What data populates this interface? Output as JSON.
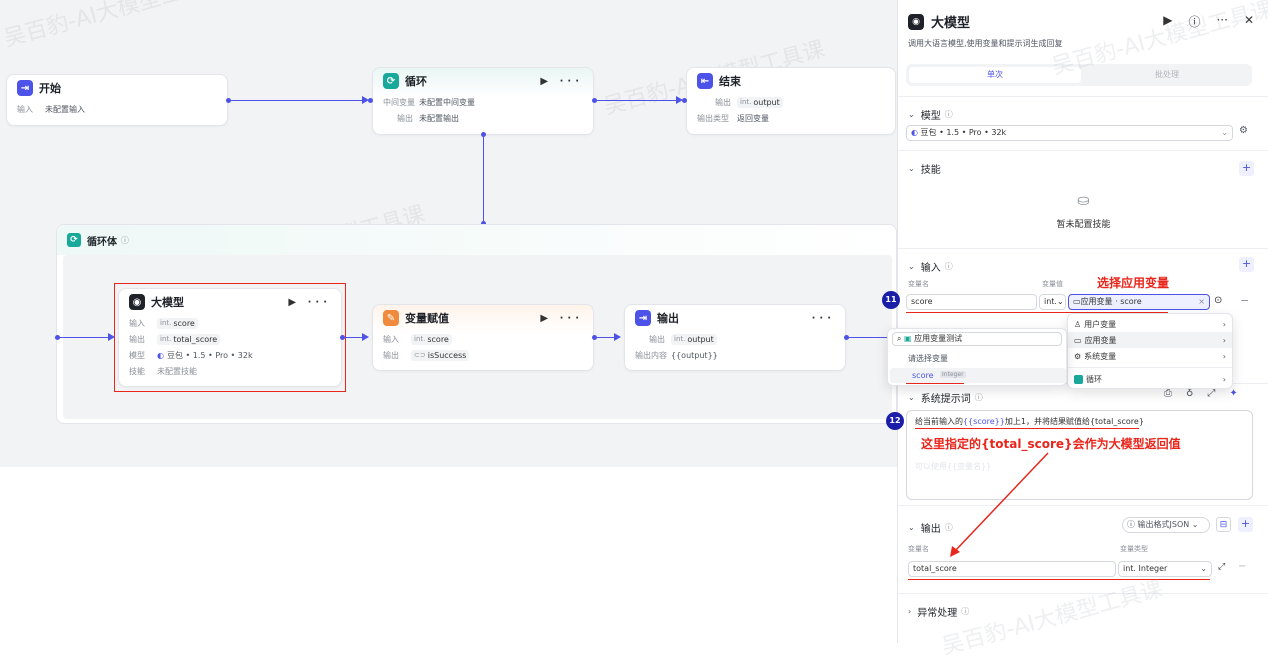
{
  "canvas": {
    "watermark": "吴百豹-AI大模型工具课",
    "start_node": {
      "title": "开始",
      "input_label": "输入",
      "input_value": "未配置输入"
    },
    "loop_node": {
      "title": "循环",
      "mid_label": "中间变量",
      "mid_value": "未配置中间变量",
      "out_label": "输出",
      "out_value": "未配置输出",
      "more": "···"
    },
    "end_node": {
      "title": "结束",
      "out_label": "输出",
      "out_type": "int.",
      "out_value": "output",
      "out_type_label": "输出类型",
      "out_type_value": "返回变量"
    },
    "loop_body": {
      "title": "循环体"
    },
    "llm_node": {
      "title": "大模型",
      "in_label": "输入",
      "in_type": "int.",
      "in_value": "score",
      "out_label": "输出",
      "out_type": "int.",
      "out_value": "total_score",
      "model_label": "模型",
      "model_value": "豆包 • 1.5 • Pro • 32k",
      "skill_label": "技能",
      "skill_value": "未配置技能",
      "more": "···"
    },
    "assign_node": {
      "title": "变量赋值",
      "in_label": "输入",
      "in_type": "int.",
      "in_value": "score",
      "out_label": "输出",
      "out_type": "⊂⊃",
      "out_value": "isSuccess",
      "more": "···"
    },
    "output_node": {
      "title": "输出",
      "out_label": "输出",
      "out_type": "int.",
      "out_value": "output",
      "content_label": "输出内容",
      "content_value": "{{output}}",
      "more": "···"
    }
  },
  "panel": {
    "title": "大模型",
    "description": "调用大语言模型,使用变量和提示词生成回复",
    "tabs": {
      "active": "单次",
      "inactive": "批处理"
    },
    "model_section": {
      "title": "模型",
      "value": "豆包 • 1.5 • Pro • 32k"
    },
    "skills_section": {
      "title": "技能",
      "empty": "暂未配置技能"
    },
    "input_section": {
      "title": "输入",
      "col_name": "变量名",
      "col_value": "变量值",
      "annotation": "选择应用变量",
      "row_name": "score",
      "row_type": "int.",
      "row_value": "应用变量 · score",
      "badge": "11"
    },
    "dropdown": {
      "items": [
        "用户变量",
        "应用变量",
        "系统变量",
        "循环"
      ],
      "search_label": "应用变量测试",
      "hint": "请选择变量",
      "option_name": "score",
      "option_type": "Integer"
    },
    "prompt_section": {
      "title": "系统提示词",
      "text_before": "给当前输入的",
      "text_var": "{{score}}",
      "text_after": "加上1，并将结果赋值给{total_score}",
      "badge": "12",
      "annotation": "这里指定的{total_score}会作为大模型返回值",
      "ghost": "可以使用{{变量名}}"
    },
    "output_section": {
      "title": "输出",
      "format": "输出格式JSON",
      "col_name": "变量名",
      "col_type": "变量类型",
      "row_name": "total_score",
      "row_type": "int. Integer"
    },
    "error_section": {
      "title": "异常处理"
    }
  },
  "colors": {
    "accent": "#4d53e8",
    "annotation": "#e8261b",
    "badge": "#1b1ea8"
  }
}
